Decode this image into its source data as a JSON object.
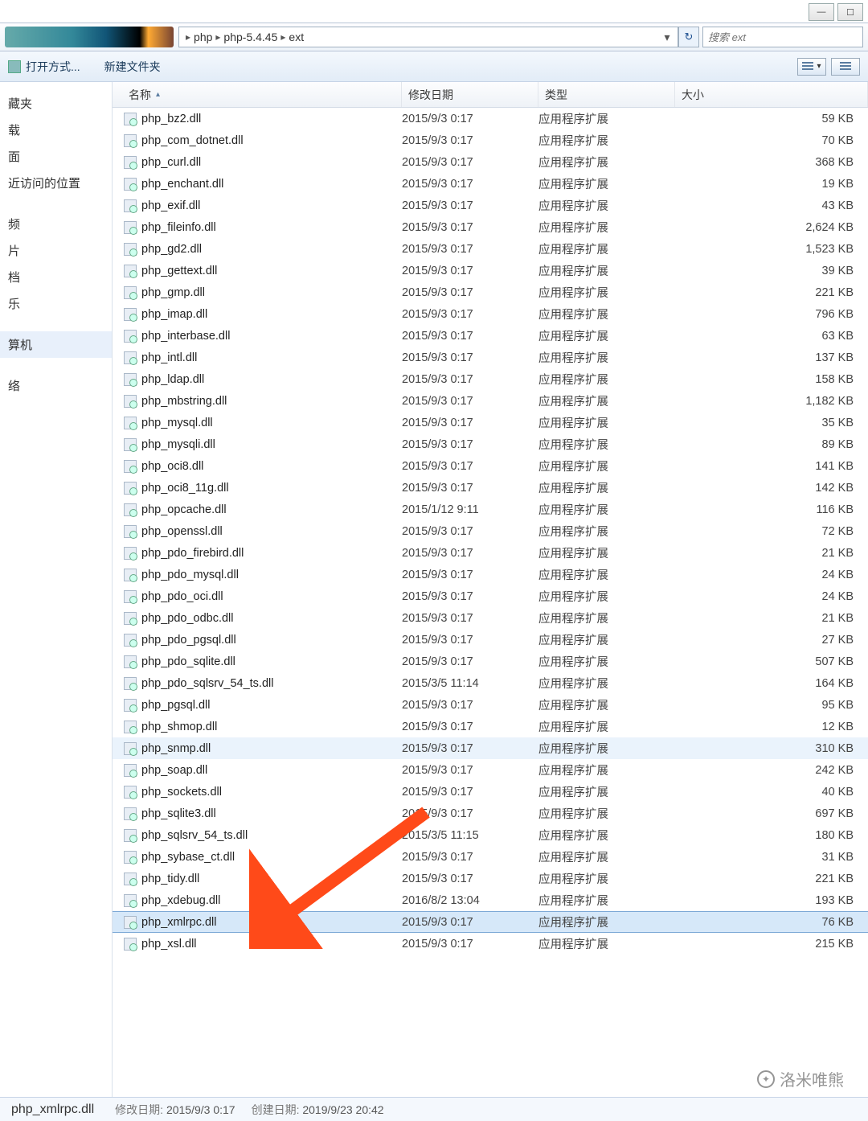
{
  "window": {
    "minimize_glyph": "—",
    "maximize_glyph": "☐",
    "close_glyph": "✕"
  },
  "addressbar": {
    "breadcrumbs": [
      "php",
      "php-5.4.45",
      "ext"
    ],
    "dropdown_glyph": "▾",
    "refresh_glyph": "↻"
  },
  "search": {
    "placeholder": "搜索 ext"
  },
  "toolbar": {
    "open_with": "打开方式...",
    "new_folder": "新建文件夹"
  },
  "sidebar": {
    "groups": [
      {
        "items": [
          "藏夹",
          "载",
          "面",
          "近访问的位置"
        ]
      },
      {
        "items": [
          "频",
          "片",
          "档",
          "乐"
        ]
      },
      {
        "items": [
          "算机"
        ],
        "selected": true
      },
      {
        "items": [
          "络"
        ]
      }
    ]
  },
  "columns": {
    "name": "名称",
    "date": "修改日期",
    "type": "类型",
    "size": "大小",
    "sort_glyph": "▴"
  },
  "default_type": "应用程序扩展",
  "files": [
    {
      "name": "php_bz2.dll",
      "date": "2015/9/3 0:17",
      "size": "59 KB"
    },
    {
      "name": "php_com_dotnet.dll",
      "date": "2015/9/3 0:17",
      "size": "70 KB"
    },
    {
      "name": "php_curl.dll",
      "date": "2015/9/3 0:17",
      "size": "368 KB"
    },
    {
      "name": "php_enchant.dll",
      "date": "2015/9/3 0:17",
      "size": "19 KB"
    },
    {
      "name": "php_exif.dll",
      "date": "2015/9/3 0:17",
      "size": "43 KB"
    },
    {
      "name": "php_fileinfo.dll",
      "date": "2015/9/3 0:17",
      "size": "2,624 KB"
    },
    {
      "name": "php_gd2.dll",
      "date": "2015/9/3 0:17",
      "size": "1,523 KB"
    },
    {
      "name": "php_gettext.dll",
      "date": "2015/9/3 0:17",
      "size": "39 KB"
    },
    {
      "name": "php_gmp.dll",
      "date": "2015/9/3 0:17",
      "size": "221 KB"
    },
    {
      "name": "php_imap.dll",
      "date": "2015/9/3 0:17",
      "size": "796 KB"
    },
    {
      "name": "php_interbase.dll",
      "date": "2015/9/3 0:17",
      "size": "63 KB"
    },
    {
      "name": "php_intl.dll",
      "date": "2015/9/3 0:17",
      "size": "137 KB"
    },
    {
      "name": "php_ldap.dll",
      "date": "2015/9/3 0:17",
      "size": "158 KB"
    },
    {
      "name": "php_mbstring.dll",
      "date": "2015/9/3 0:17",
      "size": "1,182 KB"
    },
    {
      "name": "php_mysql.dll",
      "date": "2015/9/3 0:17",
      "size": "35 KB"
    },
    {
      "name": "php_mysqli.dll",
      "date": "2015/9/3 0:17",
      "size": "89 KB"
    },
    {
      "name": "php_oci8.dll",
      "date": "2015/9/3 0:17",
      "size": "141 KB"
    },
    {
      "name": "php_oci8_11g.dll",
      "date": "2015/9/3 0:17",
      "size": "142 KB"
    },
    {
      "name": "php_opcache.dll",
      "date": "2015/1/12 9:11",
      "size": "116 KB"
    },
    {
      "name": "php_openssl.dll",
      "date": "2015/9/3 0:17",
      "size": "72 KB"
    },
    {
      "name": "php_pdo_firebird.dll",
      "date": "2015/9/3 0:17",
      "size": "21 KB"
    },
    {
      "name": "php_pdo_mysql.dll",
      "date": "2015/9/3 0:17",
      "size": "24 KB"
    },
    {
      "name": "php_pdo_oci.dll",
      "date": "2015/9/3 0:17",
      "size": "24 KB"
    },
    {
      "name": "php_pdo_odbc.dll",
      "date": "2015/9/3 0:17",
      "size": "21 KB"
    },
    {
      "name": "php_pdo_pgsql.dll",
      "date": "2015/9/3 0:17",
      "size": "27 KB"
    },
    {
      "name": "php_pdo_sqlite.dll",
      "date": "2015/9/3 0:17",
      "size": "507 KB"
    },
    {
      "name": "php_pdo_sqlsrv_54_ts.dll",
      "date": "2015/3/5 11:14",
      "size": "164 KB"
    },
    {
      "name": "php_pgsql.dll",
      "date": "2015/9/3 0:17",
      "size": "95 KB"
    },
    {
      "name": "php_shmop.dll",
      "date": "2015/9/3 0:17",
      "size": "12 KB"
    },
    {
      "name": "php_snmp.dll",
      "date": "2015/9/3 0:17",
      "size": "310 KB",
      "hl": true
    },
    {
      "name": "php_soap.dll",
      "date": "2015/9/3 0:17",
      "size": "242 KB"
    },
    {
      "name": "php_sockets.dll",
      "date": "2015/9/3 0:17",
      "size": "40 KB"
    },
    {
      "name": "php_sqlite3.dll",
      "date": "2015/9/3 0:17",
      "size": "697 KB"
    },
    {
      "name": "php_sqlsrv_54_ts.dll",
      "date": "2015/3/5 11:15",
      "size": "180 KB"
    },
    {
      "name": "php_sybase_ct.dll",
      "date": "2015/9/3 0:17",
      "size": "31 KB"
    },
    {
      "name": "php_tidy.dll",
      "date": "2015/9/3 0:17",
      "size": "221 KB"
    },
    {
      "name": "php_xdebug.dll",
      "date": "2016/8/2 13:04",
      "size": "193 KB"
    },
    {
      "name": "php_xmlrpc.dll",
      "date": "2015/9/3 0:17",
      "size": "76 KB",
      "sel": true
    },
    {
      "name": "php_xsl.dll",
      "date": "2015/9/3 0:17",
      "size": "215 KB"
    }
  ],
  "statusbar": {
    "selected_name": "php_xmlrpc.dll",
    "modified_label": "修改日期:",
    "modified_value": "2015/9/3 0:17",
    "created_label": "创建日期:",
    "created_value": "2019/9/23 20:42"
  },
  "watermark": "洛米唯熊"
}
